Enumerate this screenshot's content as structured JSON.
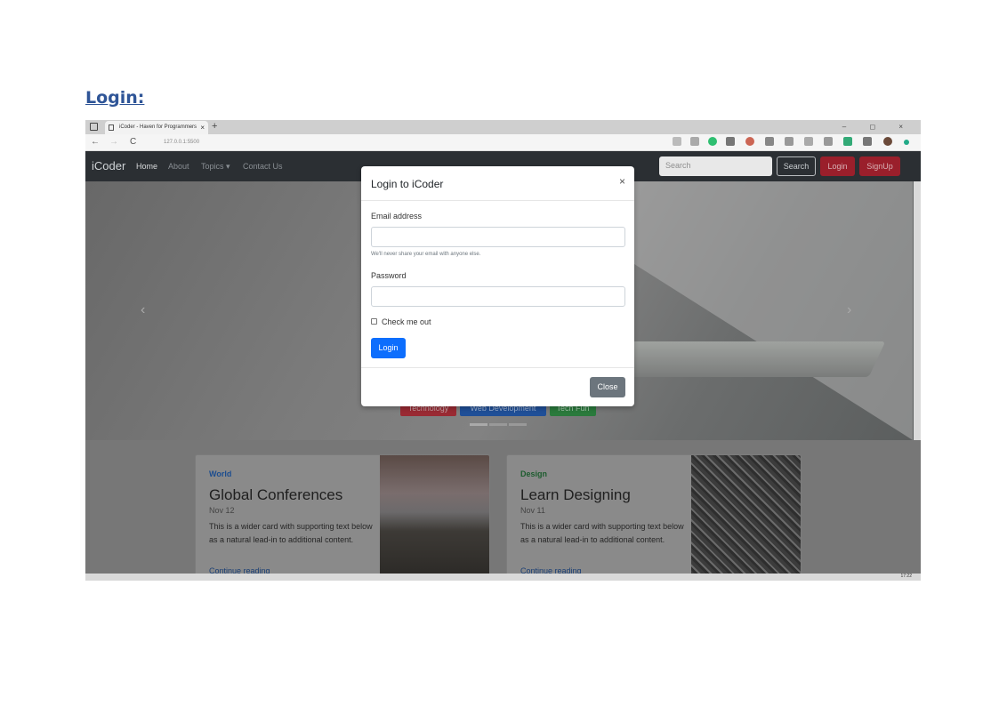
{
  "document": {
    "heading": "Login:"
  },
  "browser": {
    "tab_title": "iCoder - Haven for Programmers",
    "tab_close": "×",
    "new_tab": "+",
    "url": "127.0.0.1:5500",
    "back": "←",
    "forward": "→",
    "reload": "C",
    "window_controls": "– ◻ ×"
  },
  "navbar": {
    "brand": "iCoder",
    "links": [
      "Home",
      "About",
      "Topics ▾",
      "Contact Us"
    ],
    "search_placeholder": "Search",
    "search_button": "Search",
    "login_button": "Login",
    "signup_button": "SignUp"
  },
  "hero": {
    "prev": "‹",
    "next": "›",
    "badges": [
      {
        "label": "Technology",
        "color": "#9a2a33"
      },
      {
        "label": "Web Development",
        "color": "#1f4f98"
      },
      {
        "label": "Tech Fun",
        "color": "#2a7a3c"
      }
    ]
  },
  "cards": [
    {
      "category": "World",
      "category_color": "#1c4d8f",
      "title": "Global Conferences",
      "date": "Nov 12",
      "text": "This is a wider card with supporting text below as a natural lead-in to additional content.",
      "link": "Continue reading"
    },
    {
      "category": "Design",
      "category_color": "#1d5c2e",
      "title": "Learn Designing",
      "date": "Nov 11",
      "text": "This is a wider card with supporting text below as a natural lead-in to additional content.",
      "link": "Continue reading"
    }
  ],
  "modal": {
    "title": "Login to iCoder",
    "close_x": "×",
    "email_label": "Email address",
    "email_value": "",
    "email_help": "We'll never share your email with anyone else.",
    "password_label": "Password",
    "password_value": "",
    "checkbox_label": "Check me out",
    "checkbox_checked": false,
    "submit_button": "Login",
    "close_button": "Close"
  },
  "taskbar": {
    "time": "17:22"
  }
}
